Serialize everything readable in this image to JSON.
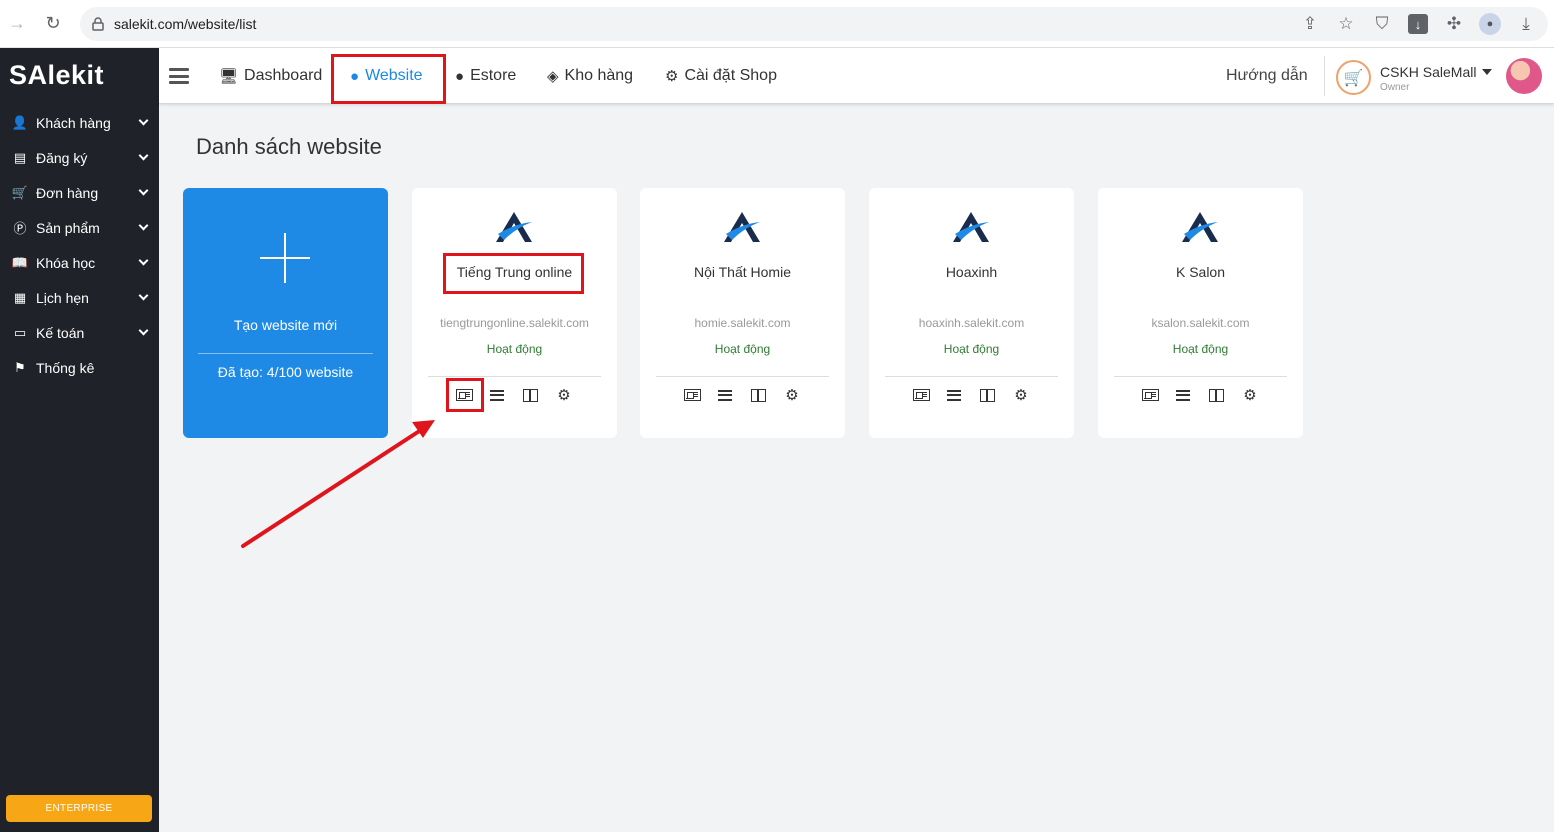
{
  "browser": {
    "url": "salekit.com/website/list"
  },
  "sidebar": {
    "logo": "SAlekit",
    "items": [
      {
        "label": "Khách hàng",
        "icon": "user-icon"
      },
      {
        "label": "Đăng ký",
        "icon": "list-icon"
      },
      {
        "label": "Đơn hàng",
        "icon": "cart-icon"
      },
      {
        "label": "Sản phẩm",
        "icon": "product-icon"
      },
      {
        "label": "Khóa học",
        "icon": "book-icon"
      },
      {
        "label": "Lịch hẹn",
        "icon": "calendar-icon"
      },
      {
        "label": "Kế toán",
        "icon": "card-icon"
      },
      {
        "label": "Thống kê",
        "icon": "flag-icon"
      }
    ],
    "plan_badge": "ENTERPRISE"
  },
  "topbar": {
    "nav": [
      {
        "label": "Dashboard",
        "icon": "monitor-icon"
      },
      {
        "label": "Website",
        "icon": "globe-icon",
        "active": true
      },
      {
        "label": "Estore",
        "icon": "globe-icon"
      },
      {
        "label": "Kho hàng",
        "icon": "layers-icon"
      },
      {
        "label": "Cài đặt Shop",
        "icon": "gear-icon"
      }
    ],
    "guide_label": "Hướng dẫn",
    "shop_name": "CSKH SaleMall",
    "shop_role": "Owner"
  },
  "main": {
    "title": "Danh sách website",
    "create_card": {
      "label": "Tạo website mới",
      "count": "Đã tạo: 4/100 website"
    },
    "sites": [
      {
        "name": "Tiếng Trung online",
        "domain": "tiengtrungonline.salekit.com",
        "status": "Hoạt động"
      },
      {
        "name": "Nội Thất Homie",
        "domain": "homie.salekit.com",
        "status": "Hoạt động"
      },
      {
        "name": "Hoaxinh",
        "domain": "hoaxinh.salekit.com",
        "status": "Hoạt động"
      },
      {
        "name": "K Salon",
        "domain": "ksalon.salekit.com",
        "status": "Hoạt động"
      }
    ]
  },
  "colors": {
    "accent": "#1e88e5",
    "highlight": "#e0141b",
    "status": "#2e7d32",
    "sidebar_bg": "#1f2229",
    "badge": "#f7a616"
  }
}
